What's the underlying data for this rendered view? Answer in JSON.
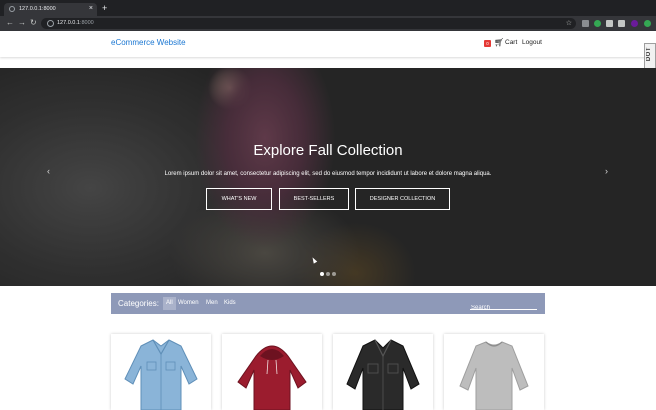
{
  "browser": {
    "tab_title": "127.0.0.1:8000",
    "tab_close": "×",
    "new_tab": "+",
    "back": "←",
    "forward": "→",
    "reload": "↻",
    "url_host": "127.0.0.1",
    "url_port": ":8000",
    "star": "☆"
  },
  "header": {
    "brand": "eCommerce Website",
    "cart_count": "0",
    "cart_label": "Cart",
    "logout_label": "Logout",
    "side_tab": "DOT"
  },
  "hero": {
    "title": "Explore Fall Collection",
    "text": "Lorem ipsum dolor sit amet, consectetur adipiscing elit, sed do eiusmod tempor incididunt ut labore et dolore magna aliqua.",
    "buttons": [
      "WHAT'S NEW",
      "BEST-SELLERS",
      "DESIGNER COLLECTION"
    ],
    "prev": "‹",
    "next": "›",
    "active_slide": 1,
    "slide_count": 3
  },
  "categories": {
    "label": "Categories:",
    "items": [
      "All",
      "Women",
      "Men",
      "Kids"
    ],
    "active": "All",
    "search_placeholder": "Search"
  },
  "products": [
    {
      "name": "denim-shirt",
      "color": "#8ab4d8"
    },
    {
      "name": "red-hoodie",
      "color": "#9b1c2e"
    },
    {
      "name": "black-denim-jacket",
      "color": "#2a2a2a"
    },
    {
      "name": "grey-sweater",
      "color": "#bdbdbd"
    }
  ],
  "colors": {
    "brand": "#1976d2",
    "category_bar": "#8e99b8",
    "badge": "#e53935"
  }
}
